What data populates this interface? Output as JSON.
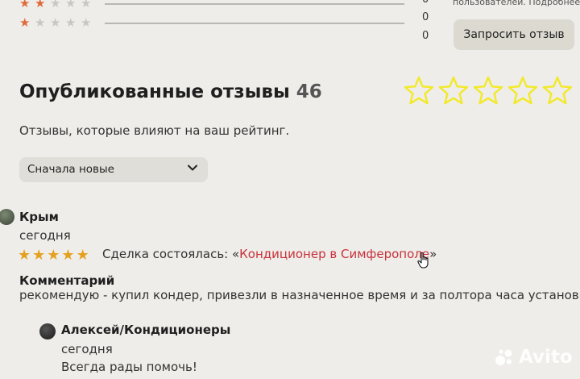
{
  "rating_breakdown": [
    {
      "stars": 2,
      "count": "0"
    },
    {
      "stars": 1,
      "count": "0"
    }
  ],
  "rating_extra_count": "0",
  "top_note": "пользователей. Подробнее",
  "request_button": "Запросить отзыв",
  "published": {
    "title": "Опубликованные отзывы",
    "count": "46",
    "subtitle": "Отзывы, которые влияют на ваш рейтинг.",
    "sort_label": "Сначала новые",
    "star_color": "#f2e92a"
  },
  "review": {
    "author": "Крым",
    "date": "сегодня",
    "rating": 5,
    "deal_prefix": "Сделка состоялась: «",
    "deal_link": "Кондиционер в Симферополе",
    "deal_suffix": "»",
    "comment_heading": "Комментарий",
    "comment": "рекомендую - купил кондер, привезли в назначенное время и за полтора часа установили"
  },
  "reply": {
    "author": "Алексей/Кондиционеры",
    "date": "сегодня",
    "text": "Всегда рады помочь!"
  },
  "watermark": "Avito",
  "colors": {
    "accent_star": "#e5a01e",
    "empty_star": "#c9c7c2",
    "link": "#c8323a"
  }
}
